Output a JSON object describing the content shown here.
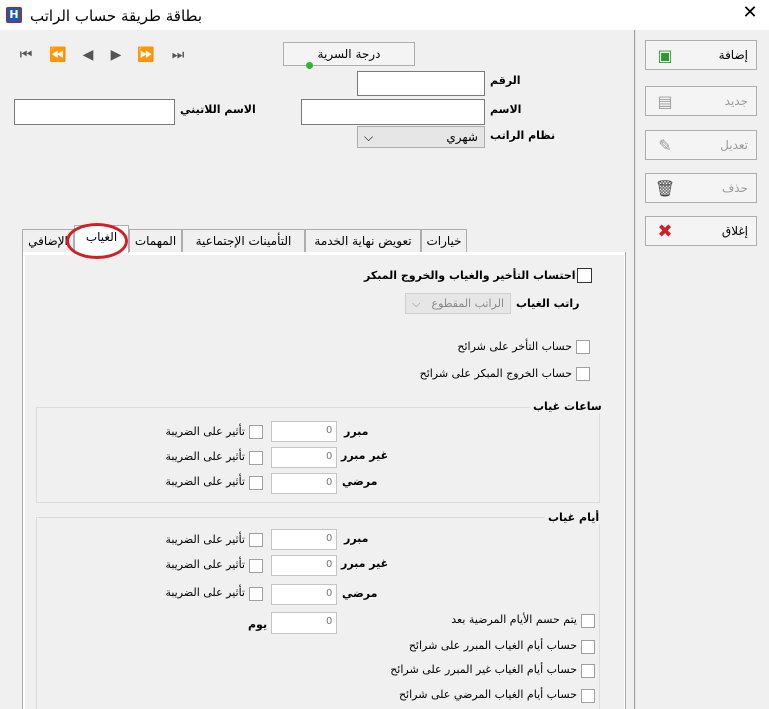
{
  "window": {
    "title": "بطاقة طريقة حساب الراتب",
    "app_icon": "H"
  },
  "nav": {
    "first": "⏮",
    "prev_fast": "⏪",
    "prev": "◀",
    "next": "▶",
    "next_fast": "⏩",
    "last": "⏭"
  },
  "confidentiality_button": "درجة السرية",
  "fields": {
    "number_label": "الرقم",
    "name_label": "الاسم",
    "latin_name_label": "الاسم اللاتيني",
    "salary_system_label": "نظام الراتب",
    "salary_system_value": "شهري"
  },
  "actions": {
    "add": "إضافة",
    "new": "جديد",
    "edit": "تعديل",
    "delete": "حذف",
    "close": "إغلاق"
  },
  "tabs": [
    "خيارات",
    "تعويض نهاية الخدمة",
    "التأمينات الإجتماعية",
    "المهمات",
    "الغياب",
    "الإضافي"
  ],
  "absence": {
    "calc_lateness_label": "احتساب التأخير والغياب والخروج المبكر",
    "absence_salary_label": "راتب الغياب",
    "absence_salary_value": "الراتب المقطوع",
    "lateness_brackets": "حساب التأخر على شرائح",
    "early_exit_brackets": "حساب الخروج المبكر على شرائح",
    "hours_group": {
      "title": "ساعات غياب",
      "rows": [
        {
          "label": "مبرر",
          "value": "0",
          "tax": "تأثير على الضريبة"
        },
        {
          "label": "غير مبرر",
          "value": "0",
          "tax": "تأثير على الضريبة"
        },
        {
          "label": "مرضي",
          "value": "0",
          "tax": "تأثير على الضريبة"
        }
      ]
    },
    "days_group": {
      "title": "أيام غياب",
      "rows": [
        {
          "label": "مبرر",
          "value": "0",
          "tax": "تأثير على الضريبة"
        },
        {
          "label": "غير مبرر",
          "value": "0",
          "tax": "تأثير على الضريبة"
        },
        {
          "label": "مرضي",
          "value": "0",
          "tax": "تأثير على الضريبة"
        }
      ],
      "sick_after_label": "يتم حسم الأيام المرضية بعد",
      "sick_after_value": "0",
      "day_unit": "يوم",
      "justified_brackets": "حساب أيام الغياب المبرر على شرائح",
      "unjustified_brackets": "حساب أيام الغياب غير المبرر على شرائح",
      "sick_brackets": "حساب أيام الغياب المرضي على شرائح"
    }
  },
  "colors": {
    "highlight_circle": "#d21f26",
    "status_dot": "#2fb52f"
  }
}
